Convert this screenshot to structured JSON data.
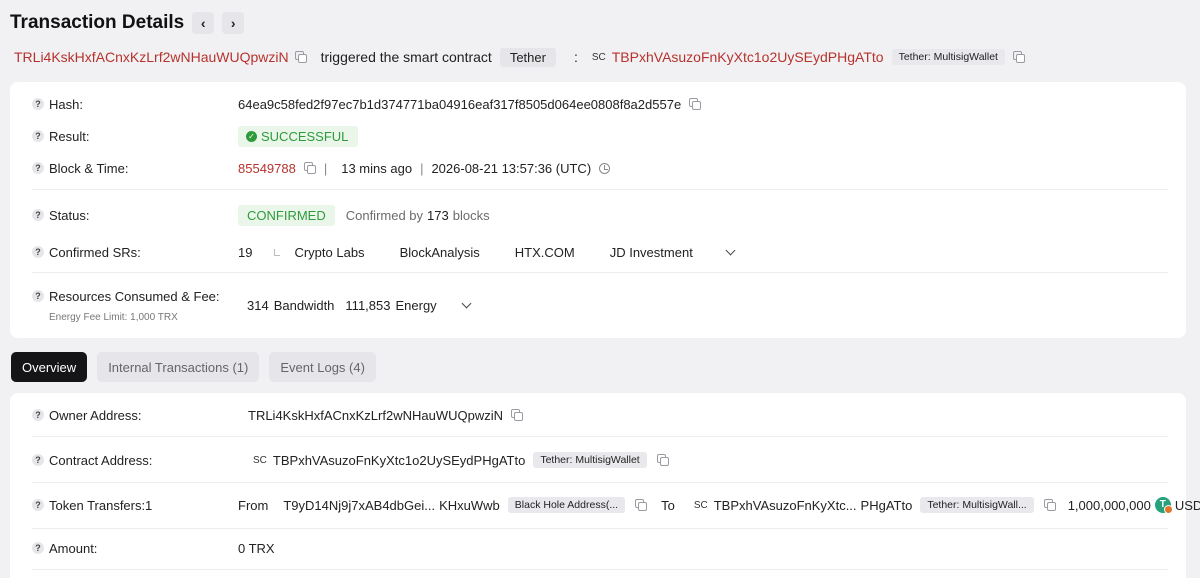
{
  "header": {
    "title": "Transaction Details",
    "prev_icon": "chevron-left-icon",
    "next_icon": "chevron-right-icon"
  },
  "summary": {
    "caller_address": "TRLi4KskHxfACnxKzLrf2wNHauWUQpwziN",
    "action_text": "triggered the smart contract",
    "contract_tag": "Tether",
    "colon": ":",
    "sc_label": "SC",
    "contract_address": "TBPxhVAsuzoFnKyXtc1o2UySEydPHgATto",
    "contract_name": "Tether: MultisigWallet"
  },
  "details": {
    "q_mark": "?",
    "hash": {
      "label": "Hash:",
      "value": "64ea9c58fed2f97ec7b1d374771ba04916eaf317f8505d064ee0808f8a2d557e"
    },
    "result": {
      "label": "Result:",
      "value": "SUCCESSFUL"
    },
    "block_time": {
      "label": "Block & Time:",
      "block": "85549788",
      "sep": "|",
      "ago": "13 mins ago",
      "datetime": "2026-08-21 13:57:36 (UTC)"
    },
    "status": {
      "label": "Status:",
      "value": "CONFIRMED",
      "confirmed_prefix": "Confirmed by",
      "confirmed_count": "173",
      "confirmed_suffix": "blocks"
    },
    "confirmed_srs": {
      "label": "Confirmed SRs:",
      "count": "19",
      "items": [
        "Crypto Labs",
        "BlockAnalysis",
        "HTX.COM",
        "JD Investment"
      ]
    },
    "resources": {
      "label": "Resources Consumed & Fee:",
      "sublabel": "Energy Fee Limit: 1,000 TRX",
      "bandwidth_value": "314",
      "bandwidth_label": "Bandwidth",
      "energy_value": "111,853",
      "energy_label": "Energy"
    }
  },
  "tabs": [
    {
      "label": "Overview",
      "active": true
    },
    {
      "label": "Internal Transactions (1)",
      "active": false
    },
    {
      "label": "Event Logs (4)",
      "active": false
    }
  ],
  "overview": {
    "owner": {
      "label": "Owner Address:",
      "value": "TRLi4KskHxfACnxKzLrf2wNHauWUQpwziN"
    },
    "contract": {
      "label": "Contract Address:",
      "sc": "SC",
      "value": "TBPxhVAsuzoFnKyXtc1o2UySEydPHgATto",
      "name": "Tether: MultisigWallet"
    },
    "token_transfers": {
      "label": "Token Transfers:",
      "count": "1",
      "from_label": "From",
      "from_addr_start": "T9yD14Nj9j7xAB4dbGei...",
      "from_addr_end": "KHxuWwb",
      "from_name": "Black Hole Address(...",
      "to_label": "To",
      "to_sc": "SC",
      "to_addr_start": "TBPxhVAsuzoFnKyXtc...",
      "to_addr_end": "PHgATto",
      "to_name": "Tether: MultisigWall...",
      "amount": "1,000,000,000",
      "token_icon_text": "T",
      "token": "USDT"
    },
    "amount": {
      "label": "Amount:",
      "value": "0 TRX"
    }
  }
}
